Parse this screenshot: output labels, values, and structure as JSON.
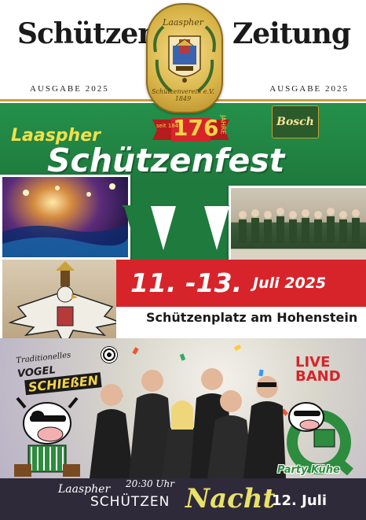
{
  "masthead": {
    "left_word": "Schützen",
    "right_word": "Zeitung",
    "edition_left": "AUSGABE 2025",
    "edition_right": "AUSGABE 2025"
  },
  "emblem": {
    "top_text": "Laaspher",
    "bottom_text": "Schützenverein e.V. 1849"
  },
  "anniversary": {
    "since": "seit 1849",
    "number": "176",
    "unit": "JAHRE"
  },
  "sponsor": {
    "name": "Bosch"
  },
  "title": {
    "line1": "Laaspher",
    "line2": "Schützenfest"
  },
  "event": {
    "dates": "11. -13.",
    "month_year": "Juli 2025",
    "venue": "Schützenplatz am Hohenstein"
  },
  "vogel": {
    "line1": "Traditionelles",
    "line2": "VOGEL",
    "line3": "SCHIEßEN"
  },
  "band": {
    "live_line1": "LIVE",
    "live_line2": "BAND",
    "name": "Party Kühe"
  },
  "night": {
    "prefix": "Laaspher",
    "time": "20:30 Uhr",
    "word1": "SCHÜTZEN",
    "word2": "Nacht",
    "date": "12. Juli"
  },
  "colors": {
    "green": "#1f7a3d",
    "red": "#d7242a",
    "gold": "#c9a23a",
    "yellow": "#f2e04a",
    "dark": "#2e2a3a"
  }
}
